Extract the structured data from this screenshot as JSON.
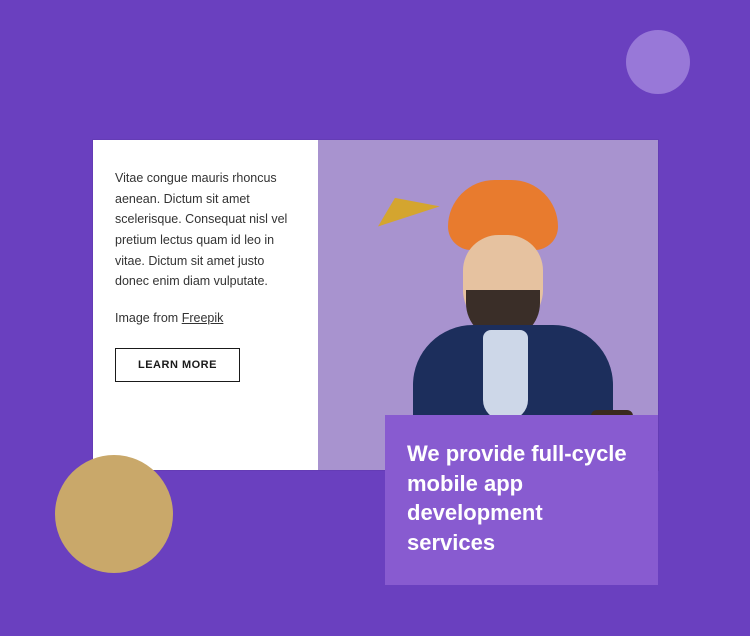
{
  "colors": {
    "bg": "#6a40bf",
    "accent": "#885bd0",
    "tan": "#c9a86a",
    "lightPurple": "#9878d8"
  },
  "card": {
    "description": "Vitae congue mauris rhoncus aenean. Dictum sit amet scelerisque. Consequat nisl vel pretium lectus quam id leo in vitae. Dictum sit amet justo donec enim diam vulputate.",
    "creditPrefix": "Image from ",
    "creditLink": "Freepik",
    "buttonLabel": "LEARN MORE"
  },
  "cta": {
    "headline": "We provide full-cycle mobile app development services"
  }
}
